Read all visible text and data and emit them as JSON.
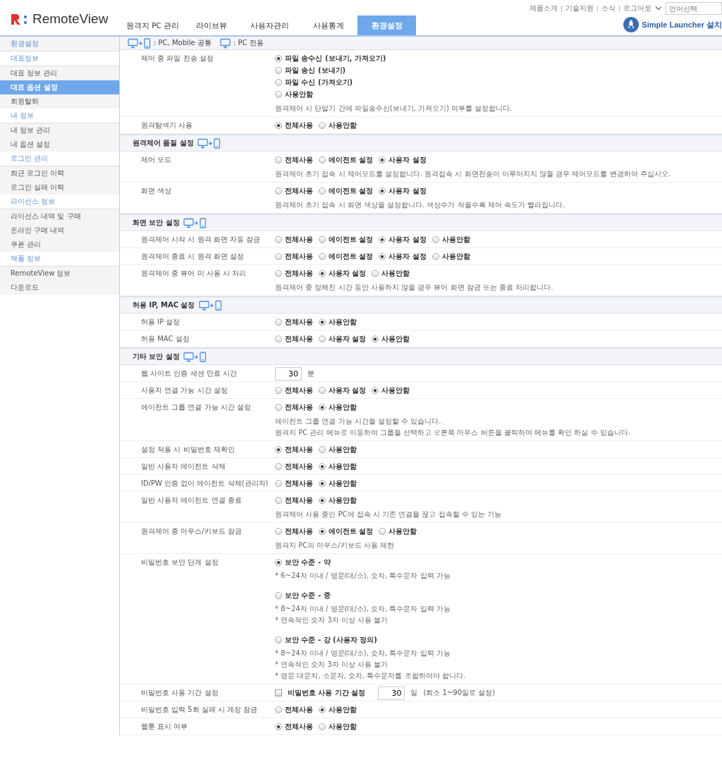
{
  "header": {
    "logo": "RemoteView",
    "top_links": [
      "제품소개",
      "기술지원",
      "소식",
      "로그아웃"
    ],
    "language_select": {
      "placeholder": "언어선택"
    },
    "tabs": [
      {
        "label": "원격지 PC 관리",
        "selected": false
      },
      {
        "label": "라이브뷰",
        "selected": false
      },
      {
        "label": "사용자관리",
        "selected": false
      },
      {
        "label": "사용통계",
        "selected": false
      },
      {
        "label": "환경설정",
        "selected": true
      }
    ],
    "launcher": "Simple Launcher 설치"
  },
  "sidebar": {
    "title": "환경설정",
    "groups": [
      {
        "title": "대표정보",
        "items": [
          {
            "label": "대표 정보 관리",
            "selected": false
          },
          {
            "label": "대표 옵션 설정",
            "selected": true
          },
          {
            "label": "회원탈퇴",
            "selected": false
          }
        ]
      },
      {
        "title": "내 정보",
        "items": [
          {
            "label": "내 정보 관리",
            "selected": false
          },
          {
            "label": "내 옵션 설정",
            "selected": false
          }
        ]
      },
      {
        "title": "로그인 관리",
        "items": [
          {
            "label": "최근 로그인 이력",
            "selected": false
          },
          {
            "label": "로그인 실패 이력",
            "selected": false
          }
        ]
      },
      {
        "title": "라이선스 정보",
        "items": [
          {
            "label": "라이선스 내역 및 구매",
            "selected": false
          },
          {
            "label": "온라인 구매 내역",
            "selected": false
          },
          {
            "label": "쿠폰 관리",
            "selected": false
          }
        ]
      },
      {
        "title": "제품 정보",
        "items": [
          {
            "label": "RemoteView 정보",
            "selected": false
          },
          {
            "label": "다운로드",
            "selected": false
          }
        ]
      }
    ]
  },
  "legend": [
    {
      "kind": "both",
      "label": ": PC, Mobile 공통"
    },
    {
      "kind": "pc",
      "label": ": PC 전용"
    }
  ],
  "sections": [
    {
      "rows": [
        {
          "kind": "radio_list",
          "label": "제어 중 파일 전송 설정",
          "options": [
            {
              "label": "파일 송수신 (보내기, 가져오기)",
              "selected": true
            },
            {
              "label": "파일 송신 (보내기)",
              "selected": false
            },
            {
              "label": "파일 수신 (가져오기)",
              "selected": false
            },
            {
              "label": "사용안함",
              "selected": false
            }
          ],
          "notes": [
            "원격제어 시 단말기 간에 파일송수신(보내기, 가져오기) 여부를 설정합니다."
          ]
        },
        {
          "kind": "radio",
          "label": "원격탐색기 사용",
          "options": [
            {
              "label": "전체사용",
              "selected": true
            },
            {
              "label": "사용안함",
              "selected": false
            }
          ]
        }
      ]
    },
    {
      "title": "원격제어 품질 설정",
      "kind": "both",
      "rows": [
        {
          "kind": "radio",
          "label": "제어 모드",
          "options": [
            {
              "label": "전체사용",
              "selected": false
            },
            {
              "label": "에이전트 설정",
              "selected": false
            },
            {
              "label": "사용자 설정",
              "selected": true
            }
          ],
          "notes": [
            "원격제어 초기 접속 시 제어모드를 설정합니다. 원격접속 시 화면전송이 이루어지지 않을 경우 제어모드를 변경하여 주십시오."
          ]
        },
        {
          "kind": "radio",
          "label": "화면 색상",
          "options": [
            {
              "label": "전체사용",
              "selected": false
            },
            {
              "label": "에이전트 설정",
              "selected": false
            },
            {
              "label": "사용자 설정",
              "selected": true
            }
          ],
          "notes": [
            "원격제어 초기 접속 시 화면 색상을 설정합니다. 색상수가 작을수록 제어 속도가 빨라집니다."
          ]
        }
      ]
    },
    {
      "title": "화면 보안 설정",
      "kind": "both",
      "rows": [
        {
          "kind": "radio",
          "label": "원격제어 시작 시 원격 화면 자동 잠금",
          "options": [
            {
              "label": "전체사용",
              "selected": false
            },
            {
              "label": "에이전트 설정",
              "selected": false
            },
            {
              "label": "사용자 설정",
              "selected": true
            },
            {
              "label": "사용안함",
              "selected": false
            }
          ]
        },
        {
          "kind": "radio",
          "label": "원격제어 종료 시 원격 화면 설정",
          "options": [
            {
              "label": "전체사용",
              "selected": false
            },
            {
              "label": "에이전트 설정",
              "selected": false
            },
            {
              "label": "사용자 설정",
              "selected": true
            },
            {
              "label": "사용안함",
              "selected": false
            }
          ]
        },
        {
          "kind": "radio",
          "label": "원격제어 중 뷰어 미 사용 시 처리",
          "options": [
            {
              "label": "전체사용",
              "selected": false
            },
            {
              "label": "사용자 설정",
              "selected": true
            },
            {
              "label": "사용안함",
              "selected": false
            }
          ],
          "notes": [
            "원격제어 중 정해진 시간 동안 사용하지 않을 경우 뷰어 화면 잠금 또는 종료 처리합니다."
          ]
        }
      ]
    },
    {
      "title": "허용 IP, MAC 설정",
      "kind": "both",
      "rows": [
        {
          "kind": "radio",
          "label": "허용 IP 설정",
          "options": [
            {
              "label": "전체사용",
              "selected": false
            },
            {
              "label": "사용안함",
              "selected": true
            }
          ]
        },
        {
          "kind": "radio",
          "label": "허용 MAC 설정",
          "options": [
            {
              "label": "전체사용",
              "selected": false
            },
            {
              "label": "사용자 설정",
              "selected": false
            },
            {
              "label": "사용안함",
              "selected": true
            }
          ]
        }
      ]
    },
    {
      "title": "기타 보안 설정",
      "kind": "both",
      "rows": [
        {
          "kind": "number",
          "label": "웹 사이트 인증 세션 만료 시간",
          "value": "30",
          "unit": "분"
        },
        {
          "kind": "radio",
          "label": "사용자 연결 가능 시간 설정",
          "options": [
            {
              "label": "전체사용",
              "selected": false
            },
            {
              "label": "사용자 설정",
              "selected": false
            },
            {
              "label": "사용안함",
              "selected": true
            }
          ]
        },
        {
          "kind": "radio",
          "label": "에이전트 그룹 연결 가능 시간 설정",
          "options": [
            {
              "label": "전체사용",
              "selected": false
            },
            {
              "label": "사용안함",
              "selected": true
            }
          ],
          "notes": [
            "에이전트 그룹 연결 가능 시간을 설정할 수 있습니다.",
            "원격지 PC 관리 메뉴로 이동하여 그룹을 선택하고 오른쪽 마우스 버튼을 클릭하여 메뉴를 확인 하실 수 있습니다."
          ]
        },
        {
          "kind": "radio",
          "label": "설정 적용 시 비밀번호 재확인",
          "options": [
            {
              "label": "전체사용",
              "selected": true
            },
            {
              "label": "사용안함",
              "selected": false
            }
          ]
        },
        {
          "kind": "radio",
          "label": "일반 사용자 에이전트 삭제",
          "options": [
            {
              "label": "전체사용",
              "selected": false
            },
            {
              "label": "사용안함",
              "selected": true
            }
          ]
        },
        {
          "kind": "radio",
          "label": "ID/PW 인증 없이 에이전트 삭제(관리자)",
          "options": [
            {
              "label": "전체사용",
              "selected": false
            },
            {
              "label": "사용안함",
              "selected": true
            }
          ]
        },
        {
          "kind": "radio",
          "label": "일반 사용자 에이전트 연결 종료",
          "options": [
            {
              "label": "전체사용",
              "selected": false
            },
            {
              "label": "사용안함",
              "selected": true
            }
          ],
          "notes": [
            "원격제어 사용 중인 PC에 접속 시 기존 연결을 끊고 접속할 수 있는 기능"
          ]
        },
        {
          "kind": "radio",
          "label": "원격제어 중 마우스/키보드 잠금",
          "options": [
            {
              "label": "전체사용",
              "selected": false
            },
            {
              "label": "에이전트 설정",
              "selected": true
            },
            {
              "label": "사용안함",
              "selected": false
            }
          ],
          "notes": [
            "원격지 PC의 마우스/키보드 사용 제한"
          ]
        },
        {
          "kind": "levels",
          "label": "비밀번호 보안 단계 설정",
          "options": [
            {
              "label": "보안 수준 - 약",
              "selected": true,
              "notes": [
                "* 6~24자 이내 / 영문(대/소), 숫자, 특수문자 입력 가능"
              ]
            },
            {
              "label": "보안 수준 - 중",
              "selected": false,
              "notes": [
                "* 8~24자 이내 / 영문(대/소), 숫자, 특수문자 입력 가능",
                "* 연속적인 숫자 3자 이상 사용 불가"
              ]
            },
            {
              "label": "보안 수준 - 강 (사용자 정의)",
              "selected": false,
              "notes": [
                "* 8~24자 이내 / 영문(대/소), 숫자, 특수문자 입력 가능",
                "* 연속적인 숫자 3자 이상 사용 불가",
                "* 영문 대문자, 소문자, 숫자, 특수문자를 조합하여야 합니다."
              ]
            }
          ]
        },
        {
          "kind": "checkbox_number",
          "label": "비밀번호 사용 기간 설정",
          "checkbox": {
            "label": "비밀번호 사용 기간 설정",
            "checked": false
          },
          "value": "30",
          "unit": "일",
          "hint": "(최소 1~90일로 설정)"
        },
        {
          "kind": "radio",
          "label": "비밀번호 입력 5회 실패 시 계정 잠금",
          "options": [
            {
              "label": "전체사용",
              "selected": false
            },
            {
              "label": "사용안함",
              "selected": true
            }
          ]
        },
        {
          "kind": "radio",
          "label": "웹툰 표시 여부",
          "options": [
            {
              "label": "전체사용",
              "selected": true
            },
            {
              "label": "사용안함",
              "selected": false
            }
          ]
        }
      ]
    }
  ]
}
